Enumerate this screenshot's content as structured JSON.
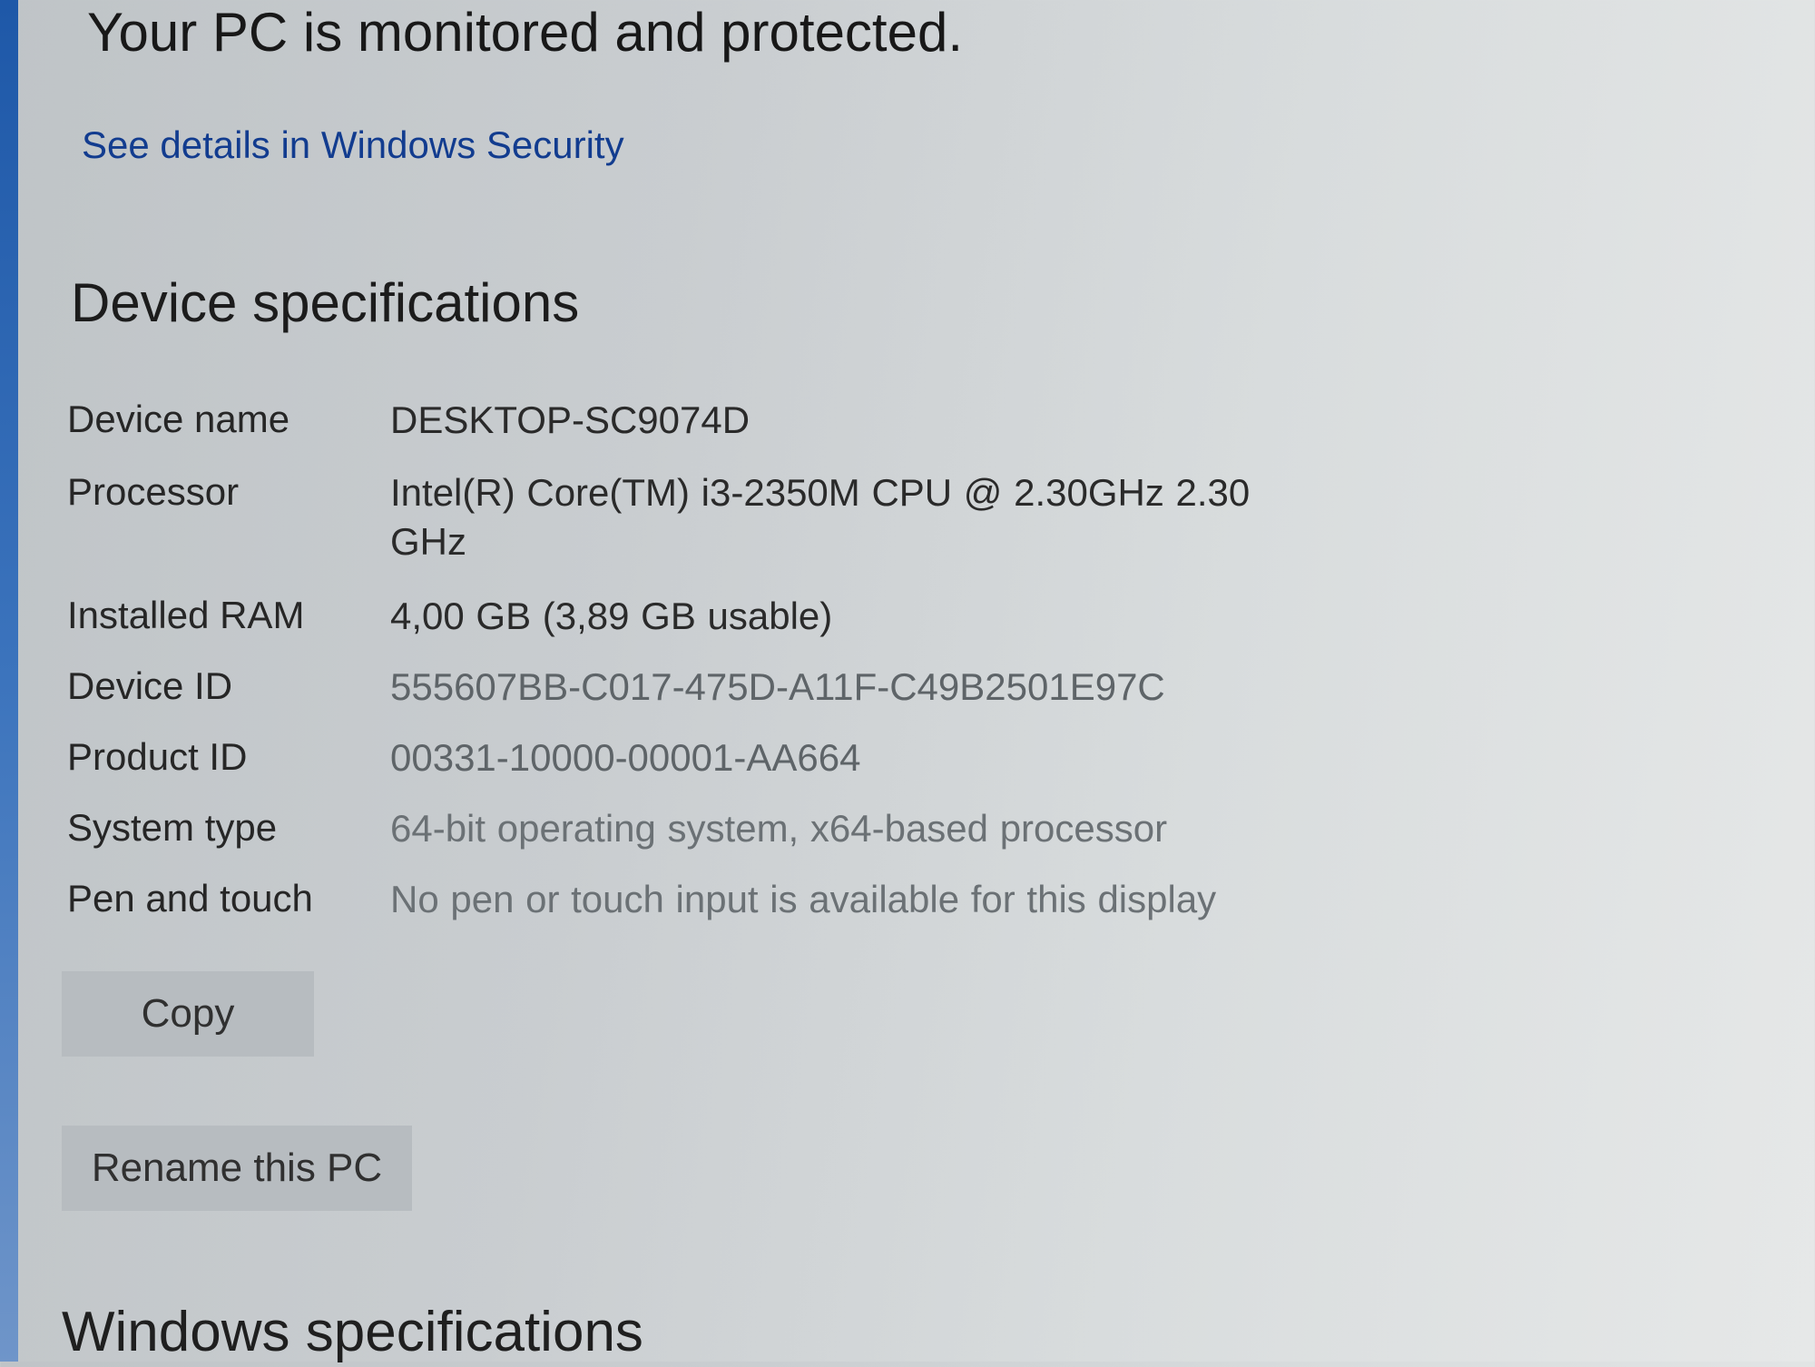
{
  "security": {
    "status": "Your PC is monitored and protected.",
    "link": "See details in Windows Security"
  },
  "device_specifications": {
    "heading": "Device specifications",
    "rows": [
      {
        "label": "Device name",
        "value": "DESKTOP-SC9074D"
      },
      {
        "label": "Processor",
        "value": "Intel(R) Core(TM) i3-2350M CPU @ 2.30GHz   2.30 GHz"
      },
      {
        "label": "Installed RAM",
        "value": "4,00 GB (3,89 GB usable)"
      },
      {
        "label": "Device ID",
        "value": "555607BB-C017-475D-A11F-C49B2501E97C"
      },
      {
        "label": "Product ID",
        "value": "00331-10000-00001-AA664"
      },
      {
        "label": "System type",
        "value": "64-bit operating system, x64-based processor"
      },
      {
        "label": "Pen and touch",
        "value": "No pen or touch input is available for this display"
      }
    ],
    "copy_button": "Copy",
    "rename_button": "Rename this PC"
  },
  "windows_specifications": {
    "heading": "Windows specifications"
  },
  "colors": {
    "link": "#123c8f",
    "accent_bar": "#1e58a8",
    "button_bg": "#b7bcc0"
  }
}
